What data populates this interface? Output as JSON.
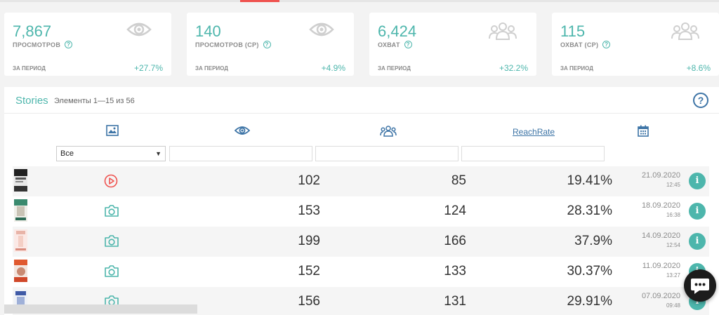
{
  "stats": [
    {
      "value": "7,867",
      "label": "ПРОСМОТРОВ",
      "period": "ЗА ПЕРИОД",
      "delta": "+27.7%",
      "icon": "eye-icon"
    },
    {
      "value": "140",
      "label": "ПРОСМОТРОВ (СР)",
      "period": "ЗА ПЕРИОД",
      "delta": "+4.9%",
      "icon": "eye-icon"
    },
    {
      "value": "6,424",
      "label": "ОХВАТ",
      "period": "ЗА ПЕРИОД",
      "delta": "+32.2%",
      "icon": "users-icon"
    },
    {
      "value": "115",
      "label": "ОХВАТ (СР)",
      "period": "ЗА ПЕРИОД",
      "delta": "+8.6%",
      "icon": "users-icon"
    }
  ],
  "panel": {
    "title": "Stories",
    "subtitle": "Элементы 1—15 из 56",
    "help_label": "?"
  },
  "columns": {
    "reachrate_label": "ReachRate",
    "icons": [
      "image-icon",
      "eye-icon",
      "users-icon",
      "calendar-icon"
    ]
  },
  "filter": {
    "type_value": "Все"
  },
  "rows": [
    {
      "type": "video",
      "views": "102",
      "reach": "85",
      "rate": "19.41%",
      "date": "21.09.2020",
      "time": "12:45"
    },
    {
      "type": "photo",
      "views": "153",
      "reach": "124",
      "rate": "28.31%",
      "date": "18.09.2020",
      "time": "16:38"
    },
    {
      "type": "photo",
      "views": "199",
      "reach": "166",
      "rate": "37.9%",
      "date": "14.09.2020",
      "time": "12:54"
    },
    {
      "type": "photo",
      "views": "152",
      "reach": "133",
      "rate": "30.37%",
      "date": "11.09.2020",
      "time": "13:27"
    },
    {
      "type": "photo",
      "views": "156",
      "reach": "131",
      "rate": "29.91%",
      "date": "07.09.2020",
      "time": "09:48"
    }
  ],
  "info_label": "i",
  "colors": {
    "accent": "#4db6ac",
    "link": "#3d74a6",
    "video": "#ef5350"
  }
}
